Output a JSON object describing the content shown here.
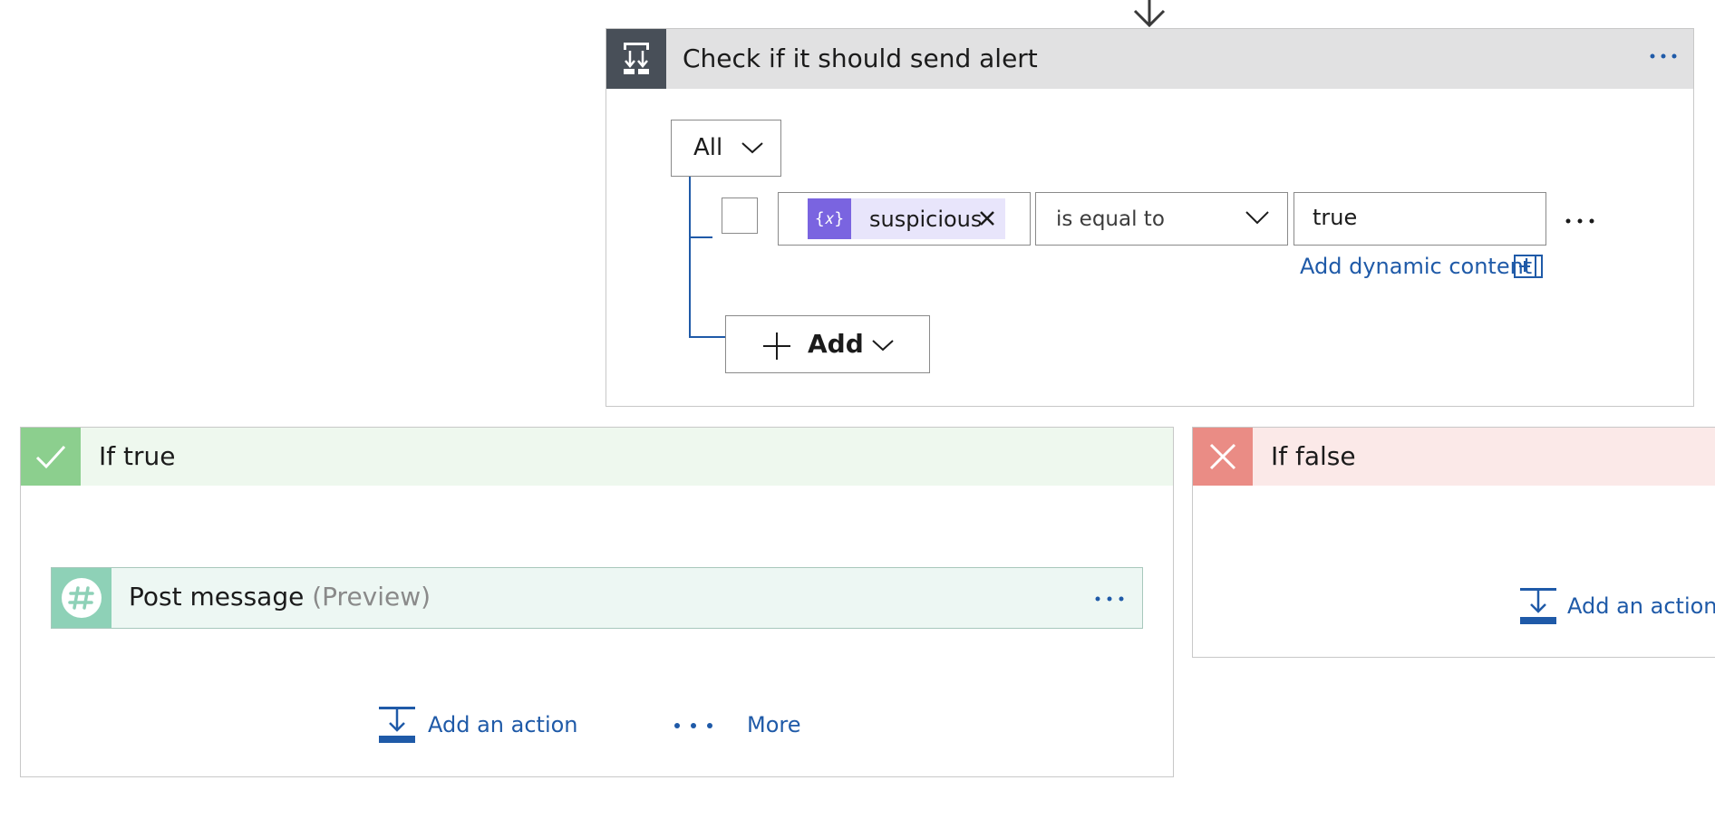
{
  "condition": {
    "title": "Check if it should send alert",
    "group_operator": "All",
    "rows": [
      {
        "token_label": "suspicious",
        "operator": "is equal to",
        "value": "true"
      }
    ],
    "add_dynamic_content_label": "Add dynamic content",
    "add_label": "Add",
    "menu_icon": "more-horizontal-icon",
    "token_icon_text": "{𝑥}"
  },
  "if_true": {
    "title": "If true",
    "action": {
      "title": "Post message",
      "preview": "(Preview)"
    },
    "add_action_label": "Add an action",
    "more_label": "More"
  },
  "if_false": {
    "title": "If false",
    "add_action_label": "Add an action"
  },
  "colors": {
    "accent": "#1f5aa8",
    "condition_icon_bg": "#484f58",
    "true_icon_bg": "#8ccf8e",
    "false_icon_bg": "#ea8c85",
    "token_icon_bg": "#7a64e0",
    "slack_icon_bg": "#8ed1b7"
  }
}
